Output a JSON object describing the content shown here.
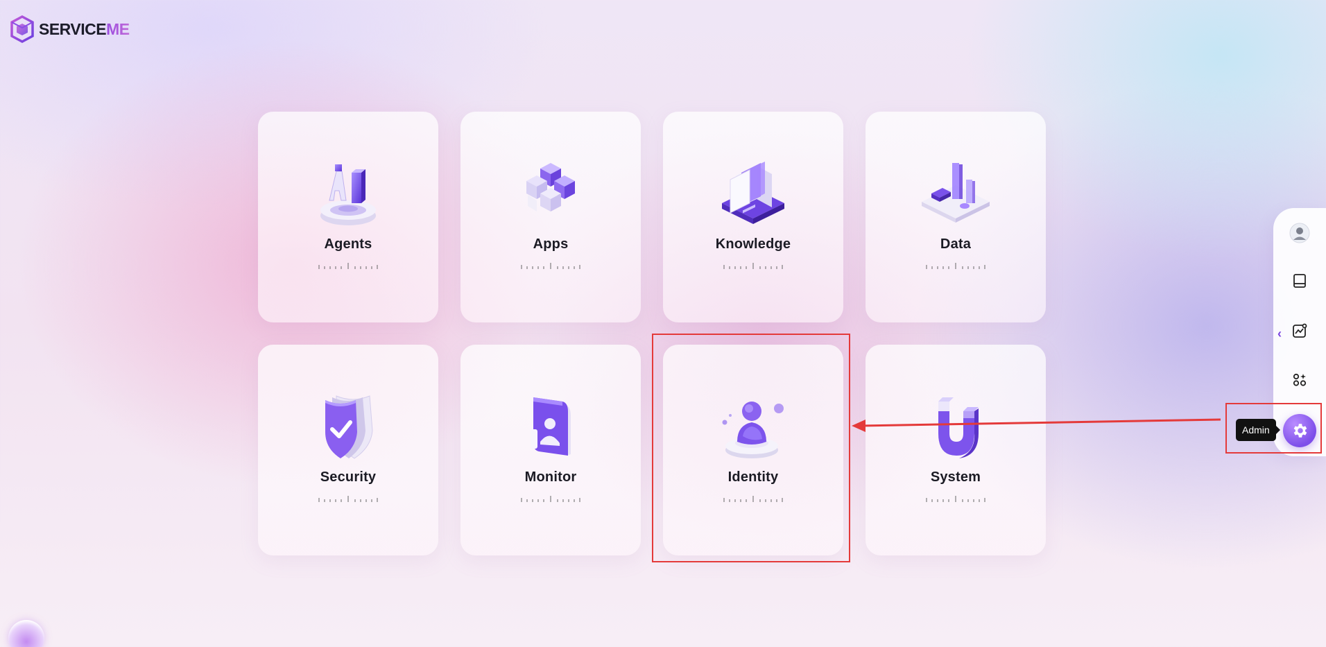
{
  "app": {
    "brand_prefix": "SERVICE",
    "brand_suffix": "ME"
  },
  "cards": [
    {
      "title": "Agents",
      "icon": "agents-ai-icon"
    },
    {
      "title": "Apps",
      "icon": "apps-cubes-icon"
    },
    {
      "title": "Knowledge",
      "icon": "knowledge-books-icon"
    },
    {
      "title": "Data",
      "icon": "data-chart-icon"
    },
    {
      "title": "Security",
      "icon": "security-shield-icon"
    },
    {
      "title": "Monitor",
      "icon": "monitor-badge-icon"
    },
    {
      "title": "Identity",
      "icon": "identity-person-icon"
    },
    {
      "title": "System",
      "icon": "system-magnet-icon"
    }
  ],
  "rail": {
    "items": [
      "user-avatar-icon",
      "book-icon",
      "analytics-icon",
      "apps-grid-icon"
    ],
    "admin_tooltip": "Admin"
  },
  "colors": {
    "accent": "#7d4ee9",
    "highlight": "#e43a3a"
  }
}
